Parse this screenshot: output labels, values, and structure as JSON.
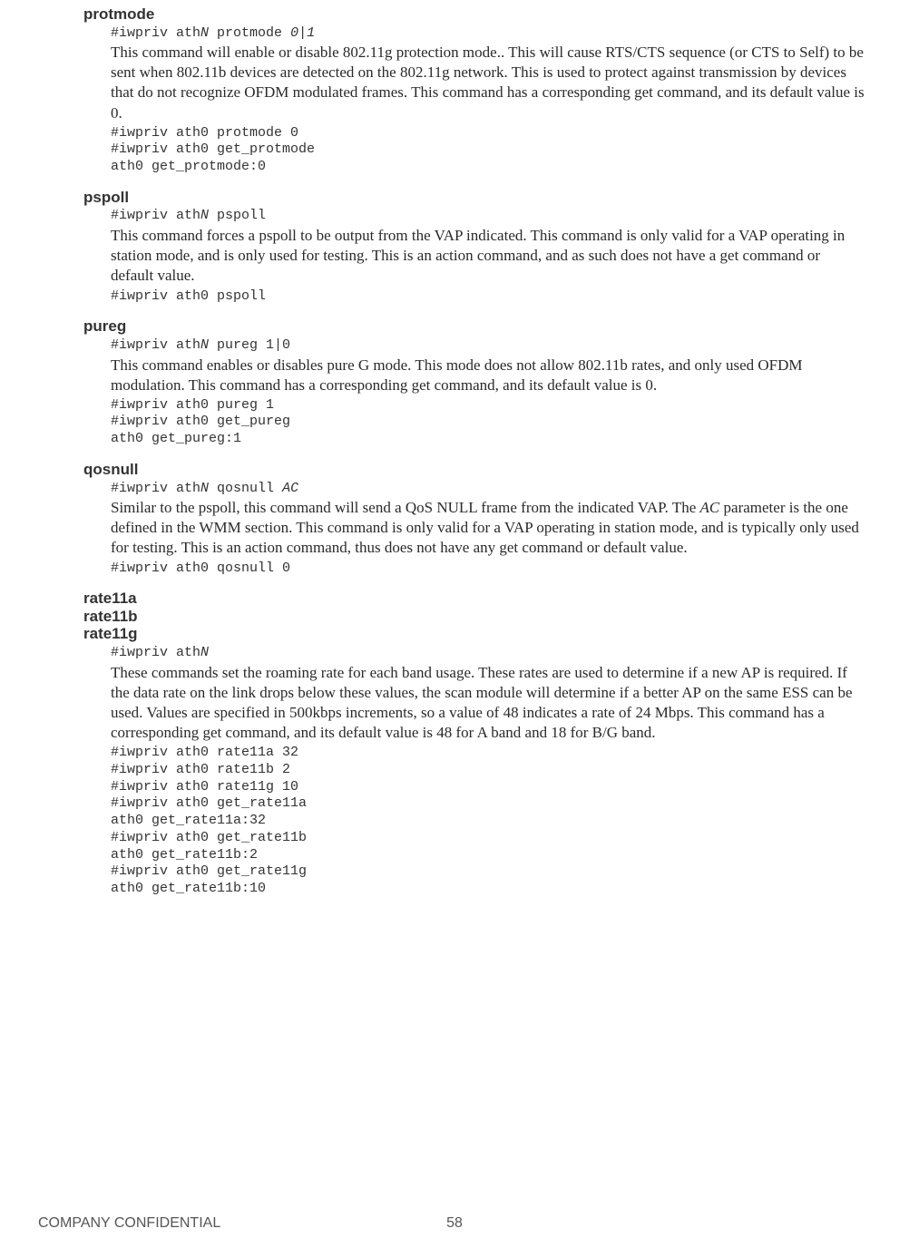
{
  "footer": {
    "confidential": "COMPANY CONFIDENTIAL",
    "page_number": "58"
  },
  "sections": [
    {
      "titles": [
        "protmode"
      ],
      "syntax_pre": "#iwpriv ath",
      "syntax_ital": "N",
      "syntax_post": " protmode ",
      "syntax_ital2": "0|1",
      "syntax_post2": "",
      "desc": "This command will enable or disable 802.11g protection mode.. This will cause RTS/CTS sequence (or CTS to Self) to be sent when 802.11b devices are detected on the 802.11g network. This is used to protect against transmission by devices that do not recognize OFDM modulated frames. This command has a corresponding get command, and its default value is 0.",
      "example": "#iwpriv ath0 protmode 0\n#iwpriv ath0 get_protmode\nath0 get_protmode:0"
    },
    {
      "titles": [
        "pspoll"
      ],
      "syntax_pre": "#iwpriv ath",
      "syntax_ital": "N",
      "syntax_post": " pspoll",
      "syntax_ital2": "",
      "syntax_post2": "",
      "desc": "This command forces a pspoll to be output from the VAP indicated. This command is only valid for a VAP operating in station mode, and is only used for testing. This is an action command, and as such does not have a get command or default value.",
      "example": "#iwpriv ath0 pspoll"
    },
    {
      "titles": [
        "pureg"
      ],
      "syntax_pre": "#iwpriv ath",
      "syntax_ital": "N",
      "syntax_post": " pureg 1|0",
      "syntax_ital2": "",
      "syntax_post2": "",
      "desc": "This command enables or disables pure G mode. This mode does not allow 802.11b rates, and only used OFDM modulation. This command has a corresponding get command, and its default value is 0.",
      "example": "#iwpriv ath0 pureg 1\n#iwpriv ath0 get_pureg\nath0 get_pureg:1"
    },
    {
      "titles": [
        "qosnull"
      ],
      "syntax_pre": "#iwpriv ath",
      "syntax_ital": "N",
      "syntax_post": " qosnull ",
      "syntax_ital2": "AC",
      "syntax_post2": "",
      "desc_parts": [
        "Similar to the pspoll, this command will send a QoS NULL frame from the indicated VAP. The ",
        " parameter is the one defined in the WMM section. This command is only valid for a VAP operating in station mode, and is typically only used for testing. This is an action command, thus does not have any get command or default value."
      ],
      "desc_ital": "AC",
      "example": "#iwpriv ath0 qosnull 0"
    },
    {
      "titles": [
        "rate11a",
        "rate11b",
        "rate11g"
      ],
      "syntax_pre": "#iwpriv ath",
      "syntax_ital": "N",
      "syntax_post": "",
      "syntax_ital2": "",
      "syntax_post2": "",
      "desc": "These commands set the roaming rate for each band usage. These rates are used to determine if a new AP is required. If the data rate on the link drops below these values, the scan module will determine if a better AP on the same ESS can be used. Values are specified in 500kbps increments, so a value of 48 indicates a rate of 24 Mbps. This command has a corresponding get command, and its default value is 48 for A band and 18 for B/G band.",
      "example": "#iwpriv ath0 rate11a 32\n#iwpriv ath0 rate11b 2\n#iwpriv ath0 rate11g 10\n#iwpriv ath0 get_rate11a\nath0 get_rate11a:32\n#iwpriv ath0 get_rate11b\nath0 get_rate11b:2\n#iwpriv ath0 get_rate11g\nath0 get_rate11b:10"
    }
  ]
}
